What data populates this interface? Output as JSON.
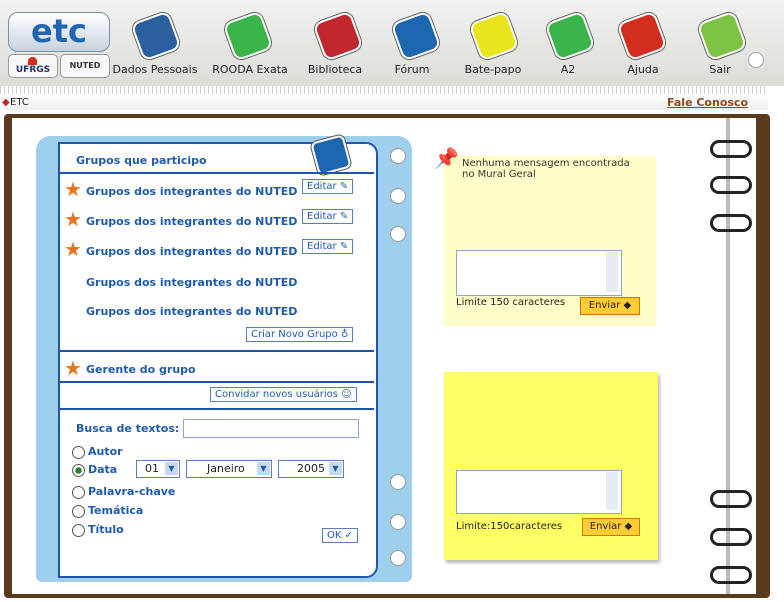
{
  "logos": {
    "etc": "etc",
    "ufrgs": "UFRGS",
    "nuted": "NUTED"
  },
  "nav": [
    {
      "label": "Dados Pessoais",
      "icon": "id-card-icon",
      "color": "#2c5f9e"
    },
    {
      "label": "ROODA Exata",
      "icon": "calculator-icon",
      "color": "#39b54a"
    },
    {
      "label": "Biblioteca",
      "icon": "book-b-icon",
      "color": "#c0282d"
    },
    {
      "label": "Fórum",
      "icon": "forum-icon",
      "color": "#1f66b1"
    },
    {
      "label": "Bate-papo",
      "icon": "chat-icon",
      "color": "#e8e51c"
    },
    {
      "label": "A2",
      "icon": "a2-icon",
      "color": "#39b54a"
    },
    {
      "label": "Ajuda",
      "icon": "help-cross-icon",
      "color": "#d32d1f"
    },
    {
      "label": "Sair",
      "icon": "exit-key-icon",
      "color": "#7dc242"
    }
  ],
  "breadcrumb": "ETC",
  "contact_link": "Fale Conosco",
  "groups": {
    "header": "Grupos que participo",
    "items": [
      {
        "name": "Grupos dos integrantes do NUTED",
        "edit": "Editar"
      },
      {
        "name": "Grupos dos integrantes do NUTED",
        "edit": "Editar"
      },
      {
        "name": "Grupos dos integrantes do NUTED",
        "edit": "Editar"
      },
      {
        "name": "Grupos dos integrantes do NUTED"
      },
      {
        "name": "Grupos dos integrantes do NUTED"
      }
    ],
    "create_btn": "Criar Novo Grupo",
    "manager": "Gerente do grupo",
    "invite_btn": "Convidar novos usuários"
  },
  "search": {
    "label": "Busca de textos:",
    "options": [
      "Autor",
      "Data",
      "Palavra-chave",
      "Temática",
      "Título"
    ],
    "selected": "Data",
    "day": "01",
    "month": "Janeiro",
    "year": "2005",
    "ok": "OK"
  },
  "mural": {
    "message": "Nenhuma mensagem encontrada no Mural Geral",
    "limit": "Limite 150 caracteres",
    "send": "Enviar"
  },
  "note2": {
    "limit": "Limite:150caracteres",
    "send": "Enviar"
  }
}
